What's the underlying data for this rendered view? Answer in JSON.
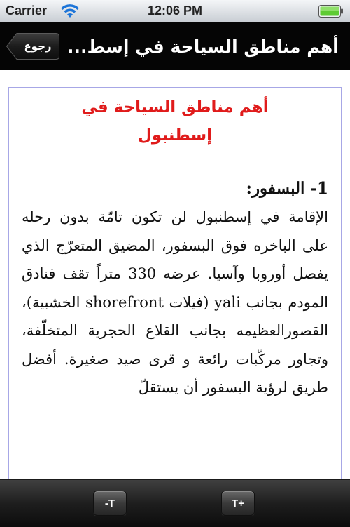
{
  "status_bar": {
    "carrier": "Carrier",
    "time": "12:06 PM",
    "wifi_icon": "wifi-icon",
    "battery_icon": "battery-icon",
    "battery_color": "#5ecb33"
  },
  "nav_bar": {
    "back_label": "رجوع",
    "title": "أهم مناطق السياحة في إسط..."
  },
  "article": {
    "title": "أهم مناطق السياحة في إسطنبول",
    "title_color": "#e01b1b",
    "section_heading": "1- البسفور:",
    "body": "الإقامة في إسطنبول لن تكون تامّة بدون رحله على الباخره فوق البسفور، المضيق المتعرّج الذي يفصل أوروبا وآسيا. عرضه 330 متراً تقف فنادق المودم بجانب yali (فيلات shorefront الخشبية)، القصورالعظيمه بجانب القلاع الحجرية المتخلّفة، وتجاور مركّبات رائعة و قرى صيد صغيرة. أفضل طريق لرؤية البسفور أن يستقلّ"
  },
  "toolbar": {
    "decrease_label": "-T",
    "increase_label": "T+"
  }
}
